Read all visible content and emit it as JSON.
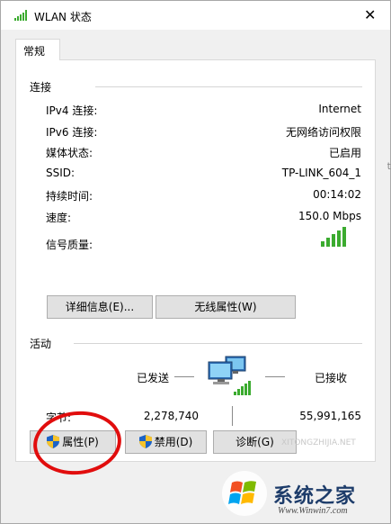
{
  "window": {
    "title": "WLAN 状态",
    "close_glyph": "✕"
  },
  "tabs": [
    {
      "label": "常规"
    }
  ],
  "connection": {
    "section_label": "连接",
    "rows": [
      {
        "label": "IPv4 连接:",
        "value": "Internet"
      },
      {
        "label": "IPv6 连接:",
        "value": "无网络访问权限"
      },
      {
        "label": "媒体状态:",
        "value": "已启用"
      },
      {
        "label": "SSID:",
        "value": "TP-LINK_604_1"
      },
      {
        "label": "持续时间:",
        "value": "00:14:02"
      },
      {
        "label": "速度:",
        "value": "150.0 Mbps"
      },
      {
        "label": "信号质量:",
        "value": ""
      }
    ],
    "details_button": "详细信息(E)...",
    "wireless_button": "无线属性(W)"
  },
  "activity": {
    "section_label": "活动",
    "sent_label": "已发送",
    "received_label": "已接收",
    "bytes_label": "字节:",
    "bytes_sent": "2,278,740",
    "bytes_received": "55,991,165"
  },
  "footer_buttons": {
    "properties": "属性(P)",
    "disable": "禁用(D)",
    "diagnose": "诊断(G)"
  },
  "watermark": {
    "brand": "系统之家",
    "url": "Www.Winwin7.com",
    "faint": "XITONGZHIJIA.NET"
  },
  "edge_fragment": "t",
  "colors": {
    "signal": "#3bab2f",
    "annotation_circle": "#e10d0d",
    "window_bg": "#f0f0f0"
  },
  "icons": {
    "title": "wifi-signal-icon",
    "activity": "network-computers-icon",
    "shield": "uac-shield-icon"
  }
}
